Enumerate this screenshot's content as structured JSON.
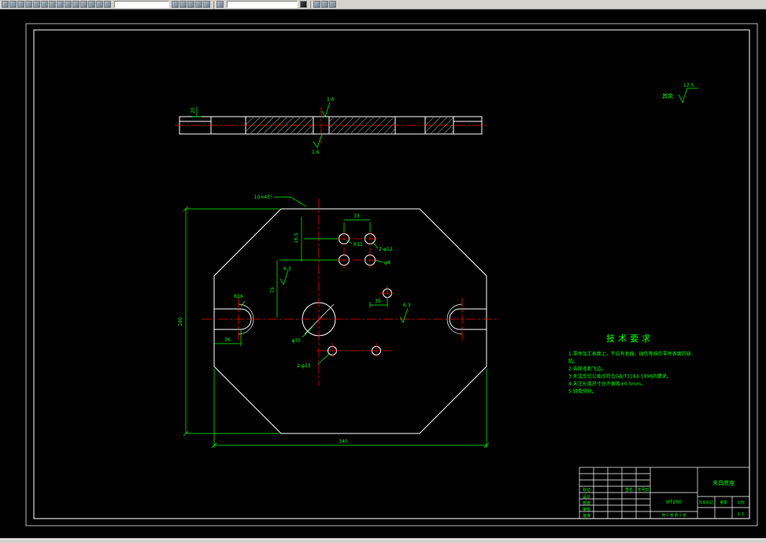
{
  "window": {
    "toolbar": {
      "layer_combo_value": "",
      "style_combo_value": ""
    }
  },
  "general_note": {
    "prefix": "其余",
    "roughness": "12.5"
  },
  "section_view": {
    "thickness_dim": "20",
    "rough_top": "1.6",
    "rough_bottom": "1.6"
  },
  "plan_view": {
    "chamfer_note": "10×45°",
    "dim_16_5": "16.5",
    "dim_33": "33",
    "radius_note": "R11",
    "holes_note_top": "2-φ12",
    "hole_note_mid": "φ8",
    "rough_left": "6.3",
    "rough_right": "6.3",
    "dim_75": "75",
    "center_dia": "φ35",
    "dim_30": "30",
    "holes_note_bottom": "2-φ13",
    "dim_36": "36",
    "slot_radius": "R16",
    "dim_height": "280",
    "dim_width": "340"
  },
  "tech_req": {
    "title": "技术要求",
    "lines": [
      "1.零件加工表面上，不应有划痕、碰伤等损伤零件表面的缺",
      "陷。",
      "2.去除毛刺飞边。",
      "3.未注形位公差应符合GB/T1184-1996的要求。",
      "4.未注长度尺寸允许偏差±0.5mm。",
      "5.锐角倒钝。"
    ]
  },
  "title_block": {
    "part_name": "夹具底座",
    "material": "HT200",
    "scale_value": "1:1",
    "sheet_info": "共 1 张 第 1 张",
    "labels": {
      "mark": "标记",
      "design": "设计",
      "check": "校核",
      "audit": "审核",
      "approve": "批准",
      "sign": "签名",
      "date": "年月日",
      "stage": "阶段标记",
      "weight": "重量",
      "scale": "比例"
    }
  }
}
